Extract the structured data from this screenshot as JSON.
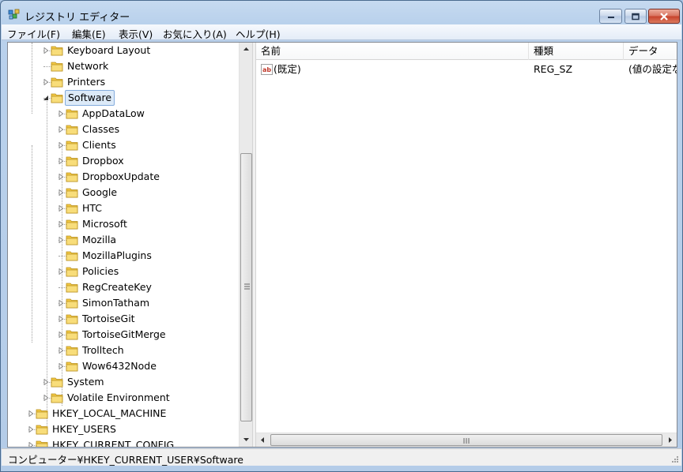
{
  "window": {
    "title": "レジストリ エディター"
  },
  "menu": [
    {
      "label": "ファイル(F)"
    },
    {
      "label": "編集(E)"
    },
    {
      "label": "表示(V)"
    },
    {
      "label": "お気に入り(A)"
    },
    {
      "label": "ヘルプ(H)"
    }
  ],
  "tree": [
    {
      "label": "Keyboard Layout",
      "level": 1,
      "expander": "collapsed"
    },
    {
      "label": "Network",
      "level": 1,
      "expander": "none"
    },
    {
      "label": "Printers",
      "level": 1,
      "expander": "collapsed"
    },
    {
      "label": "Software",
      "level": 1,
      "expander": "expanded",
      "selected": true
    },
    {
      "label": "AppDataLow",
      "level": 2,
      "expander": "collapsed"
    },
    {
      "label": "Classes",
      "level": 2,
      "expander": "collapsed"
    },
    {
      "label": "Clients",
      "level": 2,
      "expander": "collapsed"
    },
    {
      "label": "Dropbox",
      "level": 2,
      "expander": "collapsed"
    },
    {
      "label": "DropboxUpdate",
      "level": 2,
      "expander": "collapsed"
    },
    {
      "label": "Google",
      "level": 2,
      "expander": "collapsed"
    },
    {
      "label": "HTC",
      "level": 2,
      "expander": "collapsed"
    },
    {
      "label": "Microsoft",
      "level": 2,
      "expander": "collapsed"
    },
    {
      "label": "Mozilla",
      "level": 2,
      "expander": "collapsed"
    },
    {
      "label": "MozillaPlugins",
      "level": 2,
      "expander": "none"
    },
    {
      "label": "Policies",
      "level": 2,
      "expander": "collapsed"
    },
    {
      "label": "RegCreateKey",
      "level": 2,
      "expander": "none"
    },
    {
      "label": "SimonTatham",
      "level": 2,
      "expander": "collapsed"
    },
    {
      "label": "TortoiseGit",
      "level": 2,
      "expander": "collapsed"
    },
    {
      "label": "TortoiseGitMerge",
      "level": 2,
      "expander": "collapsed"
    },
    {
      "label": "Trolltech",
      "level": 2,
      "expander": "collapsed"
    },
    {
      "label": "Wow6432Node",
      "level": 2,
      "expander": "collapsed"
    },
    {
      "label": "System",
      "level": 1,
      "expander": "collapsed"
    },
    {
      "label": "Volatile Environment",
      "level": 1,
      "expander": "collapsed"
    },
    {
      "label": "HKEY_LOCAL_MACHINE",
      "level": 0,
      "expander": "collapsed"
    },
    {
      "label": "HKEY_USERS",
      "level": 0,
      "expander": "collapsed"
    },
    {
      "label": "HKEY_CURRENT_CONFIG",
      "level": 0,
      "expander": "collapsed"
    }
  ],
  "list": {
    "columns": [
      {
        "label": "名前"
      },
      {
        "label": "種類"
      },
      {
        "label": "データ"
      }
    ],
    "rows": [
      {
        "name": "(既定)",
        "type": "REG_SZ",
        "data": "(値の設定な"
      }
    ]
  },
  "status": {
    "path": "コンピューター¥HKEY_CURRENT_USER¥Software"
  },
  "colors": {
    "folder": "#f3c843",
    "selection": "#dceaf8",
    "selection_border": "#84acdd"
  }
}
